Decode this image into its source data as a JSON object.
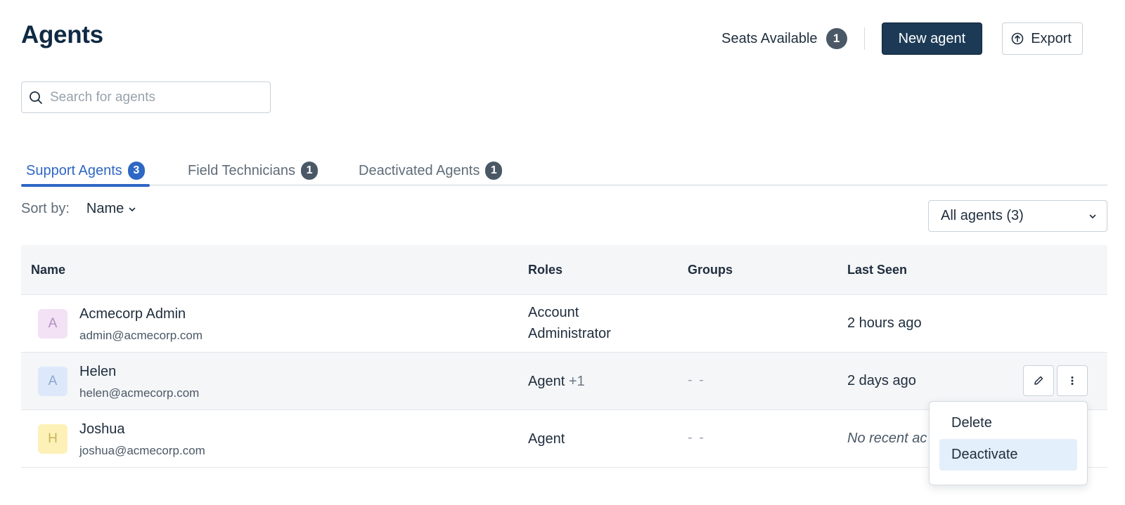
{
  "header": {
    "title": "Agents",
    "seats_label": "Seats Available",
    "seats_count": "1",
    "new_agent_label": "New agent",
    "export_label": "Export"
  },
  "search": {
    "placeholder": "Search for agents"
  },
  "tabs": [
    {
      "label": "Support Agents",
      "count": "3",
      "active": true
    },
    {
      "label": "Field Technicians",
      "count": "1",
      "active": false
    },
    {
      "label": "Deactivated Agents",
      "count": "1",
      "active": false
    }
  ],
  "sort": {
    "label": "Sort by:",
    "value": "Name"
  },
  "filter": {
    "value": "All agents (3)"
  },
  "table": {
    "headers": {
      "name": "Name",
      "roles": "Roles",
      "groups": "Groups",
      "last_seen": "Last Seen"
    },
    "rows": [
      {
        "initial": "A",
        "avatar_bg": "#f3e1f6",
        "avatar_fg": "#b58fc0",
        "name": "Acmecorp Admin",
        "email": "admin@acmecorp.com",
        "roles_line1": "Account",
        "roles_line2": "Administrator",
        "groups": "",
        "last_seen": "2 hours ago"
      },
      {
        "initial": "A",
        "avatar_bg": "#dde9fb",
        "avatar_fg": "#8aa6cf",
        "name": "Helen",
        "email": "helen@acmecorp.com",
        "roles": "Agent",
        "roles_extra": "+1",
        "groups": "- -",
        "last_seen": "2 days ago"
      },
      {
        "initial": "H",
        "avatar_bg": "#fdf1b8",
        "avatar_fg": "#c9b35a",
        "name": "Joshua",
        "email": "joshua@acmecorp.com",
        "roles": "Agent",
        "groups": "- -",
        "last_seen": "No recent ac"
      }
    ]
  },
  "menu": {
    "items": [
      "Delete",
      "Deactivate"
    ]
  },
  "icons": {
    "search": "search-icon",
    "export": "export-icon",
    "chevron": "chevron-down-icon",
    "edit": "pencil-icon",
    "more": "more-vertical-icon"
  },
  "colors": {
    "primary": "#1c3a56",
    "accent": "#2e67c4",
    "badge": "#4a5866",
    "menu_highlight": "#e3effa"
  }
}
